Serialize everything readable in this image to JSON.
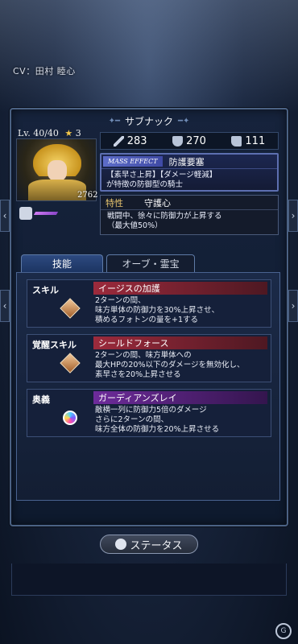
{
  "cv": "CV：田村 睦心",
  "character": {
    "name": "サブナック",
    "level": "Lv. 40/40",
    "stars": "3",
    "power": "2762"
  },
  "stats": {
    "attack": "283",
    "defense": "270",
    "speed": "111"
  },
  "mass_effect": {
    "tag": "MASS EFFECT",
    "title": "防護要塞",
    "desc1": "【素早さ上昇】【ダメージ軽減】",
    "desc2": "が特徴の防御型の騎士"
  },
  "trait": {
    "label": "特性",
    "name": "守護心",
    "desc1": "戦闘中、徐々に防御力が上昇する",
    "desc2": "（最大値50%）"
  },
  "tabs": {
    "skills": "技能",
    "orb": "オーブ・霊宝"
  },
  "skills": [
    {
      "category": "スキル",
      "name": "イージスの加護",
      "lines": [
        "2ターンの間、",
        "味方単体の防御力を30%上昇させ、",
        "積めるフォトンの量を+1する"
      ]
    },
    {
      "category": "覚醒スキル",
      "name": "シールドフォース",
      "lines": [
        "2ターンの間、味方単体への",
        "最大HPの20%以下のダメージを無効化し、",
        "素早さを20%上昇させる"
      ]
    },
    {
      "category": "奥義",
      "name": "ガーディアンズレイ",
      "lines": [
        "敵横一列に防御力5倍のダメージ",
        "さらに2ターンの間、",
        "味方全体の防御力を20%上昇させる"
      ]
    }
  ],
  "status_button": "ステータス",
  "colors": {
    "skill_red": "#9c2a3c",
    "ultimate_purple": "#6d2b9a",
    "gold": "#e9c66f"
  }
}
